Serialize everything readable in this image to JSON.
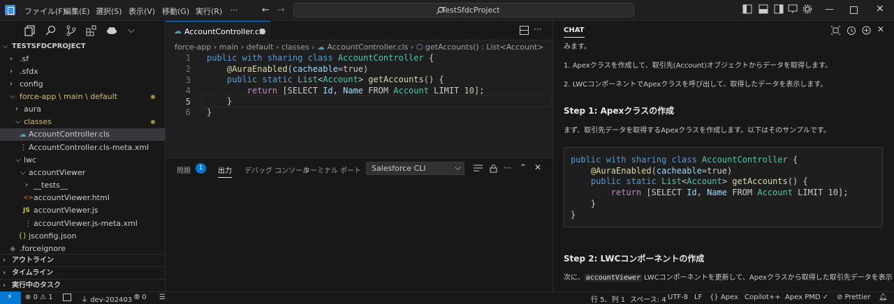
{
  "titlebar": {
    "menus": [
      "ファイル(F)",
      "編集(E)",
      "選択(S)",
      "表示(V)",
      "移動(G)",
      "実行(R)",
      "···"
    ],
    "search": "TestSfdcProject"
  },
  "explorer": {
    "project": "TESTSFDCPROJECT",
    "items": [
      {
        "label": ".sf"
      },
      {
        "label": ".sfdx"
      },
      {
        "label": "config"
      },
      {
        "label": "force-app \\ main \\ default"
      },
      {
        "label": "aura"
      },
      {
        "label": "classes"
      },
      {
        "label": "AccountController.cls"
      },
      {
        "label": "AccountController.cls-meta.xml"
      },
      {
        "label": "lwc"
      },
      {
        "label": "accountViewer"
      },
      {
        "label": "__tests__"
      },
      {
        "label": "accountViewer.html"
      },
      {
        "label": "accountViewer.js"
      },
      {
        "label": "accountViewer.js-meta.xml"
      },
      {
        "label": "jsconfig.json"
      },
      {
        "label": ".forceignore"
      }
    ],
    "sections": [
      "アウトライン",
      "タイムライン",
      "実行中のタスク"
    ]
  },
  "editor": {
    "tab": "AccountController.cls",
    "breadcrumb": [
      "force-app",
      "main",
      "default",
      "classes",
      "AccountController.cls",
      "getAccounts() : List<Account>"
    ],
    "line_numbers": [
      "1",
      "2",
      "3",
      "4",
      "5",
      "6"
    ],
    "code": [
      "public with sharing class AccountController {",
      "    @AuraEnabled(cacheable=true)",
      "    public static List<Account> getAccounts() {",
      "        return [SELECT Id, Name FROM Account LIMIT 10];",
      "    }",
      "}"
    ]
  },
  "panel": {
    "tabs": [
      "問題",
      "出力",
      "デバッグ コンソール",
      "ターミナル",
      "ポート"
    ],
    "problems_count": "1",
    "output_channel": "Salesforce CLI"
  },
  "chat": {
    "title": "CHAT",
    "lines": [
      "みます。",
      "1. Apexクラスを作成して、取引先(Account)オブジェクトからデータを取得します。",
      "2. LWCコンポーネントでApexクラスを呼び出して、取得したデータを表示します。"
    ],
    "step1_heading": "Step 1: Apexクラスの作成",
    "step1_text": "まず、取引先データを取得するApexクラスを作成します。以下はそのサンプルです。",
    "step2_heading": "Step 2: LWCコンポーネントの作成",
    "step2_text_pre": "次に、",
    "step2_code": "accountViewer",
    "step2_text_post": " LWCコンポーネントを更新して、Apexクラスから取得した取引先データを表示しま す。"
  },
  "status": {
    "errors": "0",
    "warnings": "1",
    "branch": "dev-202403",
    "ports": "0",
    "position": "行 5、列 1",
    "spaces": "スペース: 4",
    "encoding": "UTF-8",
    "eol": "LF",
    "language": "Apex",
    "copilot": "Copilot++",
    "pmd": "Apex PMD ✓",
    "prettier": "Prettier"
  }
}
